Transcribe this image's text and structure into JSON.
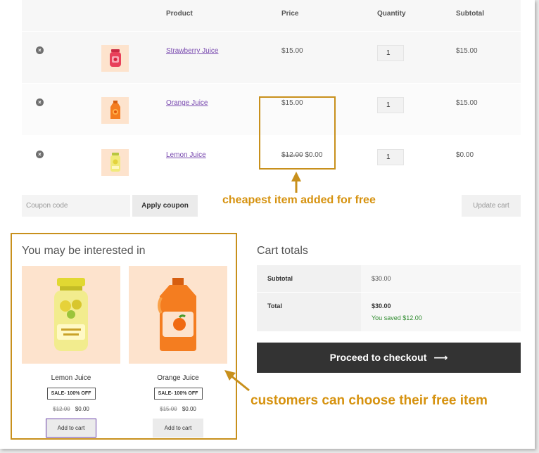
{
  "table": {
    "headers": {
      "product": "Product",
      "price": "Price",
      "quantity": "Quantity",
      "subtotal": "Subtotal"
    },
    "rows": [
      {
        "name": "Strawberry Juice",
        "price": "$15.00",
        "price_old": "",
        "price_new": "",
        "qty": "1",
        "subtotal": "$15.00",
        "thumb_color": "#e8405a"
      },
      {
        "name": "Orange Juice",
        "price": "$15.00",
        "price_old": "",
        "price_new": "",
        "qty": "1",
        "subtotal": "$15.00",
        "thumb_color": "#f47d20"
      },
      {
        "name": "Lemon Juice",
        "price": "",
        "price_old": "$12.00",
        "price_new": "$0.00",
        "qty": "1",
        "subtotal": "$0.00",
        "thumb_color": "#e7e15a"
      }
    ]
  },
  "actions": {
    "coupon_placeholder": "Coupon code",
    "apply_label": "Apply coupon",
    "update_label": "Update cart"
  },
  "annotations": {
    "free_item": "cheapest item added for free",
    "choose_item": "customers can choose their free item",
    "color": "#c8901c"
  },
  "related": {
    "title": "You may be interested in",
    "products": [
      {
        "name": "Lemon Juice",
        "badge": "SALE- 100% OFF",
        "old_price": "$12.00",
        "new_price": "$0.00",
        "button": "Add to cart"
      },
      {
        "name": "Orange Juice",
        "badge": "SALE- 100% OFF",
        "old_price": "$15.00",
        "new_price": "$0.00",
        "button": "Add to cart"
      }
    ]
  },
  "totals": {
    "title": "Cart totals",
    "subtotal_label": "Subtotal",
    "subtotal_value": "$30.00",
    "total_label": "Total",
    "total_value": "$30.00",
    "saved_text": "You saved $12.00",
    "saved_color": "#2e8b2e"
  },
  "checkout": {
    "label": "Proceed to checkout",
    "arrow": "⟶"
  }
}
